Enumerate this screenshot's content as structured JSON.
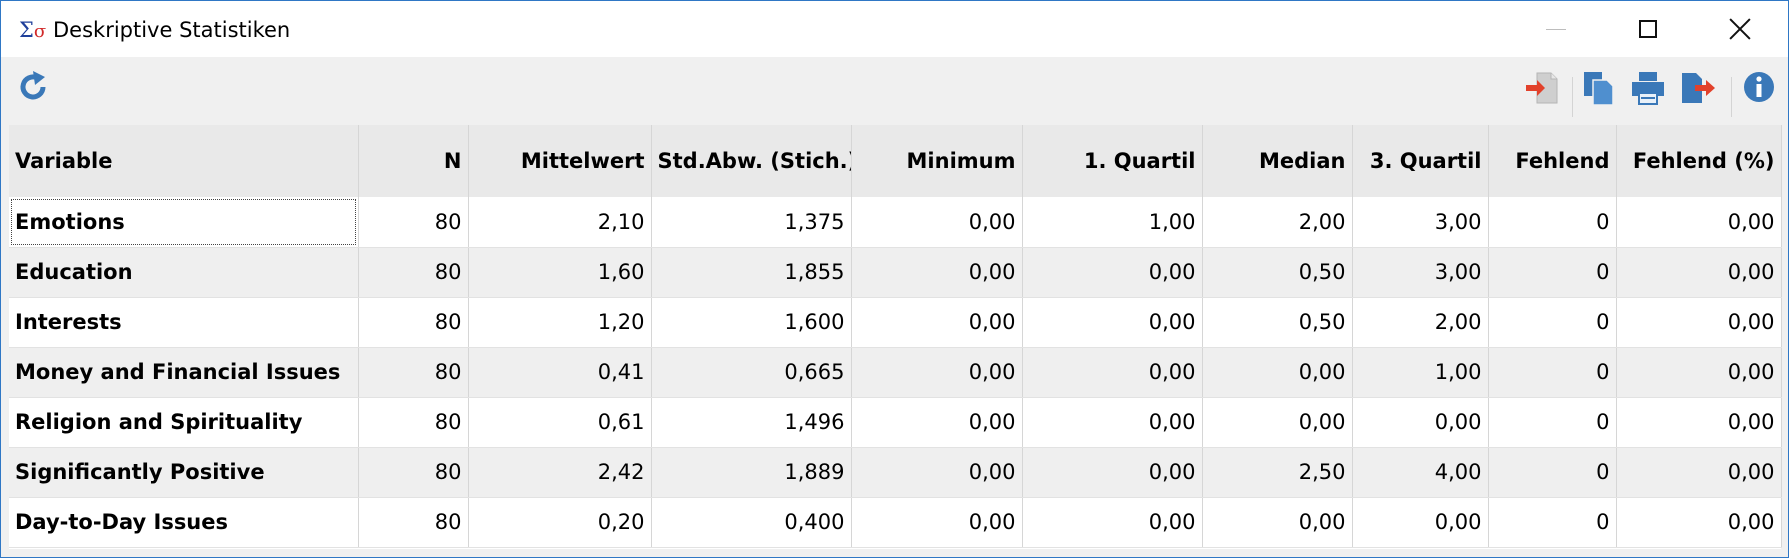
{
  "window": {
    "title": "Deskriptive Statistiken",
    "app_icon": "sigma-sigma-icon",
    "controls": [
      "minimize-icon",
      "maximize-icon",
      "close-icon"
    ]
  },
  "toolbar": {
    "left": [
      {
        "icon": "refresh-icon"
      }
    ],
    "right": [
      {
        "icon": "import-icon"
      },
      {
        "icon": "copy-icon"
      },
      {
        "icon": "print-icon"
      },
      {
        "icon": "export-icon"
      },
      {
        "icon": "info-icon"
      }
    ],
    "colors": {
      "blue": "#3a78b8",
      "red": "#e2412b"
    }
  },
  "table": {
    "headers": [
      "Variable",
      "N",
      "Mittelwert",
      "Std.Abw. (Stich.)",
      "Minimum",
      "1. Quartil",
      "Median",
      "3. Quartil",
      "Fehlend",
      "Fehlend (%)"
    ],
    "rows": [
      [
        "Emotions",
        "80",
        "2,10",
        "1,375",
        "0,00",
        "1,00",
        "2,00",
        "3,00",
        "0",
        "0,00"
      ],
      [
        "Education",
        "80",
        "1,60",
        "1,855",
        "0,00",
        "0,00",
        "0,50",
        "3,00",
        "0",
        "0,00"
      ],
      [
        "Interests",
        "80",
        "1,20",
        "1,600",
        "0,00",
        "0,00",
        "0,50",
        "2,00",
        "0",
        "0,00"
      ],
      [
        "Money and Financial Issues",
        "80",
        "0,41",
        "0,665",
        "0,00",
        "0,00",
        "0,00",
        "1,00",
        "0",
        "0,00"
      ],
      [
        "Religion and Spirituality",
        "80",
        "0,61",
        "1,496",
        "0,00",
        "0,00",
        "0,00",
        "0,00",
        "0",
        "0,00"
      ],
      [
        "Significantly Positive",
        "80",
        "2,42",
        "1,889",
        "0,00",
        "0,00",
        "2,50",
        "4,00",
        "0",
        "0,00"
      ],
      [
        "Day-to-Day Issues",
        "80",
        "0,20",
        "0,400",
        "0,00",
        "0,00",
        "0,00",
        "0,00",
        "0",
        "0,00"
      ]
    ]
  }
}
